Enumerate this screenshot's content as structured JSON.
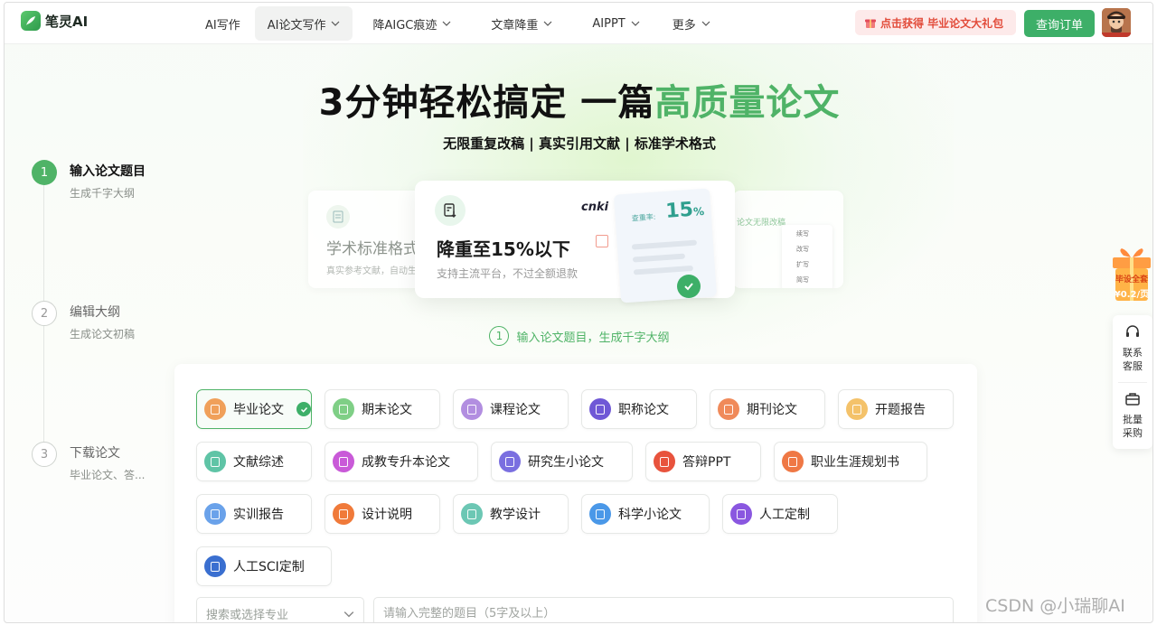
{
  "header": {
    "logo_text": "笔灵AI",
    "nav": [
      {
        "label": "AI写作",
        "has_menu": false,
        "active": false
      },
      {
        "label": "AI论文写作",
        "has_menu": true,
        "active": true
      },
      {
        "label": "降AIGC痕迹",
        "has_menu": true,
        "active": false
      },
      {
        "label": "文章降重",
        "has_menu": true,
        "active": false
      },
      {
        "label": "AIPPT",
        "has_menu": true,
        "active": false
      },
      {
        "label": "更多",
        "has_menu": true,
        "active": false
      }
    ],
    "promo": "点击获得 毕业论文大礼包",
    "order_button": "查询订单"
  },
  "hero": {
    "title_black": "3分钟轻松搞定 一篇",
    "title_green": "高质量论文",
    "subtitle": "无限重复改稿 | 真实引用文献 | 标准学术格式"
  },
  "steps": [
    {
      "num": "1",
      "title": "输入论文题目",
      "desc": "生成千字大纲",
      "active": true
    },
    {
      "num": "2",
      "title": "编辑大纲",
      "desc": "生成论文初稿",
      "active": false
    },
    {
      "num": "3",
      "title": "下载论文",
      "desc": "毕业论文、答...",
      "active": false
    }
  ],
  "cards": {
    "left_title": "学术标准格式",
    "left_desc": "真实参考文献，自动生",
    "main_title": "降重至15%以下",
    "main_desc": "支持主流平台，不过全额退款",
    "cnki": "cnki",
    "rate_label": "查重率:",
    "rate_value": "15",
    "rate_unit": "%",
    "right_title": "论文无限改稿",
    "right_items": [
      "续写",
      "改写",
      "扩写",
      "简写"
    ]
  },
  "current_step": {
    "num": "1",
    "text": "输入论文题目，生成千字大纲"
  },
  "paper_types": [
    {
      "label": "毕业论文",
      "color": "#f0a05a",
      "selected": true
    },
    {
      "label": "期末论文",
      "color": "#7fcf86",
      "selected": false
    },
    {
      "label": "课程论文",
      "color": "#b28ee0",
      "selected": false
    },
    {
      "label": "职称论文",
      "color": "#6f58d6",
      "selected": false
    },
    {
      "label": "期刊论文",
      "color": "#f08a5a",
      "selected": false
    },
    {
      "label": "开题报告",
      "color": "#f4c26a",
      "selected": false
    },
    {
      "label": "文献综述",
      "color": "#5fc4a6",
      "selected": false
    },
    {
      "label": "成教专升本论文",
      "color": "#c95ad8",
      "selected": false
    },
    {
      "label": "研究生小论文",
      "color": "#7a6fe0",
      "selected": false
    },
    {
      "label": "答辩PPT",
      "color": "#e8533d",
      "selected": false
    },
    {
      "label": "职业生涯规划书",
      "color": "#ef7845",
      "selected": false
    },
    {
      "label": "实训报告",
      "color": "#6aa2ea",
      "selected": false
    },
    {
      "label": "设计说明",
      "color": "#f07a3a",
      "selected": false
    },
    {
      "label": "教学设计",
      "color": "#6cc7b4",
      "selected": false
    },
    {
      "label": "科学小论文",
      "color": "#4a98e8",
      "selected": false
    },
    {
      "label": "人工定制",
      "color": "#8a57e0",
      "selected": false
    },
    {
      "label": "人工SCI定制",
      "color": "#3a6fd0",
      "selected": false
    }
  ],
  "inputs": {
    "major_placeholder": "搜索或选择专业",
    "topic_placeholder": "请输入完整的题目（5字及以上）"
  },
  "sidebar": {
    "gift_text": "毕设全套",
    "gift_price": "¥0.2/页",
    "service": "联系客服",
    "bulk": "批量采购"
  },
  "watermark": "CSDN @小瑞聊AI"
}
